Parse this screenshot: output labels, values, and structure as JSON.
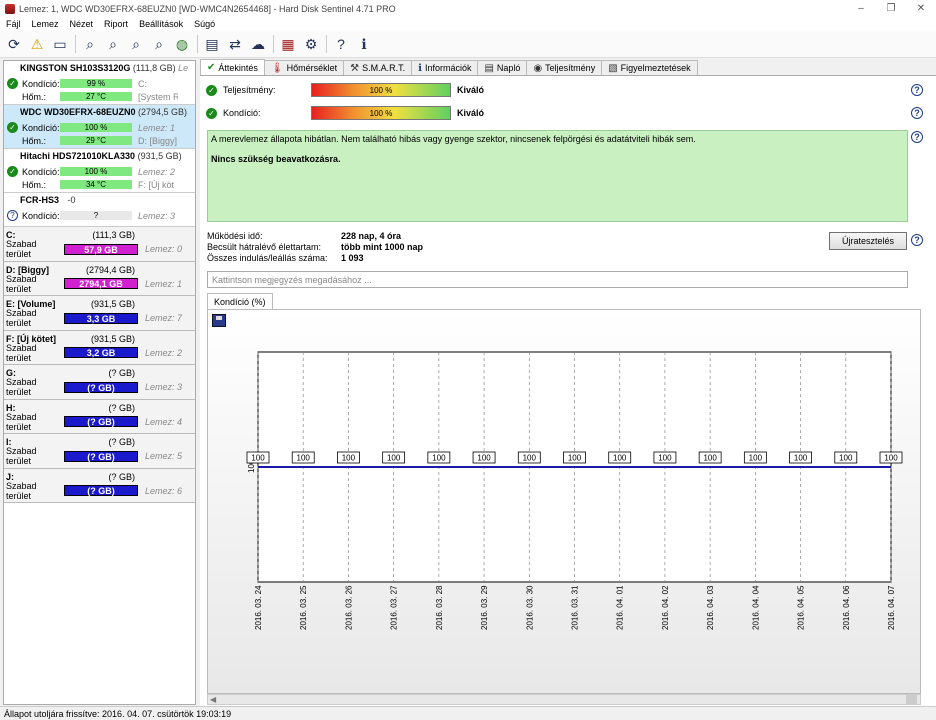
{
  "window": {
    "title": "Lemez: 1, WDC WD30EFRX-68EUZN0 [WD-WMC4N2654468]  -  Hard Disk Sentinel 4.71 PRO",
    "min": "–",
    "max": "❐",
    "close": "✕"
  },
  "menu": [
    "Fájl",
    "Lemez",
    "Nézet",
    "Riport",
    "Beállítások",
    "Súgó"
  ],
  "disks": [
    {
      "name": "KINGSTON SH103S3120G",
      "size": "(111,8 GB)",
      "sub": "Le",
      "condition_label": "Kondíció:",
      "condition": "99 %",
      "cond_extra": "C:",
      "temp_label": "Hőm.:",
      "temp": "27 °C",
      "temp_extra": "[System R"
    },
    {
      "name": "WDC WD30EFRX-68EUZN0",
      "size": "(2794,5 GB)",
      "sub": "",
      "condition_label": "Kondíció:",
      "condition": "100 %",
      "cond_extra": "Lemez: 1",
      "temp_label": "Hőm.:",
      "temp": "29 °C",
      "temp_extra": "D: [Biggy]"
    },
    {
      "name": "Hitachi HDS721010KLA330",
      "size": "(931,5 GB)",
      "sub": "",
      "condition_label": "Kondíció:",
      "condition": "100 %",
      "cond_extra": "Lemez: 2",
      "temp_label": "Hőm.:",
      "temp": "34 °C",
      "temp_extra": "F: [Új köt"
    },
    {
      "name": "FCR-HS3",
      "size": "-0",
      "sub": "",
      "condition_label": "Kondíció:",
      "condition": "?",
      "cond_extra": "Lemez: 3"
    }
  ],
  "volumes": [
    {
      "name": "C:",
      "size": "(111,3 GB)",
      "free_label": "Szabad terület",
      "free": "57,9 GB",
      "disk": "Lemez: 0",
      "color": "#d020d0"
    },
    {
      "name": "D: [Biggy]",
      "size": "(2794,4 GB)",
      "free_label": "Szabad terület",
      "free": "2794,1 GB",
      "disk": "Lemez: 1",
      "color": "#d020d0"
    },
    {
      "name": "E: [Volume]",
      "size": "(931,5 GB)",
      "free_label": "Szabad terület",
      "free": "3,3 GB",
      "disk": "Lemez: 7",
      "color": "#1a1acc"
    },
    {
      "name": "F: [Új kötet]",
      "size": "(931,5 GB)",
      "free_label": "Szabad terület",
      "free": "3,2 GB",
      "disk": "Lemez: 2",
      "color": "#1a1acc"
    },
    {
      "name": "G:",
      "size": "(? GB)",
      "free_label": "Szabad terület",
      "free": "(? GB)",
      "disk": "Lemez: 3",
      "color": "#1a1acc"
    },
    {
      "name": "H:",
      "size": "(? GB)",
      "free_label": "Szabad terület",
      "free": "(? GB)",
      "disk": "Lemez: 4",
      "color": "#1a1acc"
    },
    {
      "name": "I:",
      "size": "(? GB)",
      "free_label": "Szabad terület",
      "free": "(? GB)",
      "disk": "Lemez: 5",
      "color": "#1a1acc"
    },
    {
      "name": "J:",
      "size": "(? GB)",
      "free_label": "Szabad terület",
      "free": "(? GB)",
      "disk": "Lemez: 6",
      "color": "#1a1acc"
    }
  ],
  "tabs": [
    {
      "label": "Áttekintés",
      "icon": "check-icon"
    },
    {
      "label": "Hőmérséklet",
      "icon": "thermometer-icon"
    },
    {
      "label": "S.M.A.R.T.",
      "icon": "smart-icon"
    },
    {
      "label": "Információk",
      "icon": "info-icon"
    },
    {
      "label": "Napló",
      "icon": "log-icon"
    },
    {
      "label": "Teljesítmény",
      "icon": "performance-icon"
    },
    {
      "label": "Figyelmeztetések",
      "icon": "alerts-icon"
    }
  ],
  "overview": {
    "performance_label": "Teljesítmény:",
    "performance": "100 %",
    "performance_rating": "Kiváló",
    "condition_label": "Kondíció:",
    "condition": "100 %",
    "condition_rating": "Kiváló",
    "message": "A merevlemez állapota hibátlan. Nem található hibás vagy gyenge szektor, nincsenek felpörgési és adatátviteli hibák sem.",
    "message2": "Nincs szükség beavatkozásra.",
    "uptime_label": "Működési idő:",
    "uptime": "228 nap, 4 óra",
    "lifetime_label": "Becsült hátralévő élettartam:",
    "lifetime": "több mint 1000 nap",
    "starts_label": "Összes indulás/leállás száma:",
    "starts": "1 093",
    "retest": "Újratesztelés",
    "note_placeholder": "Kattintson megjegyzés megadásához ...",
    "chart_tab": "Kondíció  (%)"
  },
  "chart_data": {
    "type": "line",
    "categories": [
      "2016. 03. 24",
      "2016. 03. 25",
      "2016. 03. 26",
      "2016. 03. 27",
      "2016. 03. 28",
      "2016. 03. 29",
      "2016. 03. 30",
      "2016. 03. 31",
      "2016. 04. 01",
      "2016. 04. 02",
      "2016. 04. 03",
      "2016. 04. 04",
      "2016. 04. 05",
      "2016. 04. 06",
      "2016. 04. 07"
    ],
    "series": [
      {
        "values": [
          100,
          100,
          100,
          100,
          100,
          100,
          100,
          100,
          100,
          100,
          100,
          100,
          100,
          100,
          100
        ],
        "color": "#1a1aaa"
      }
    ],
    "y_tick": "100",
    "grid": "vertical dashed"
  },
  "status": "Állapot utoljára frissítve: 2016. 04. 07. csütörtök 19:03:19"
}
